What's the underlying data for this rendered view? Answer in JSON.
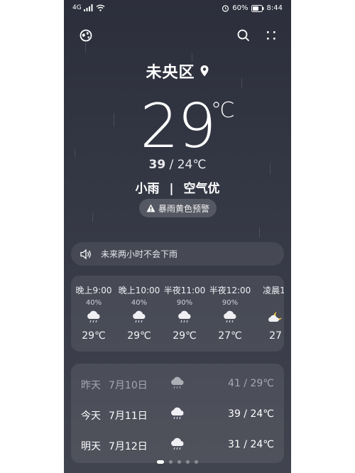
{
  "status_bar": {
    "left_text": "4G",
    "battery": "60%",
    "time": "8:44"
  },
  "location": {
    "city": "未央区"
  },
  "current": {
    "temperature": "29",
    "unit": "℃",
    "high": "39",
    "low_with_unit": "24℃",
    "condition": "小雨",
    "air_quality": "空气优"
  },
  "alert": {
    "text": "暴雨黄色预警"
  },
  "rain_notice": {
    "text": "未来两小时不会下雨"
  },
  "hourly": [
    {
      "time": "晚上9:00",
      "prob": "40%",
      "icon": "rain-cloud-icon",
      "temp": "29℃"
    },
    {
      "time": "晚上10:00",
      "prob": "40%",
      "icon": "rain-cloud-icon",
      "temp": "29℃"
    },
    {
      "time": "半夜11:00",
      "prob": "90%",
      "icon": "rain-cloud-icon",
      "temp": "29℃"
    },
    {
      "time": "半夜12:00",
      "prob": "90%",
      "icon": "rain-cloud-icon",
      "temp": "27℃"
    },
    {
      "time": "凌晨1:",
      "prob": "",
      "icon": "moon-cloud-icon",
      "temp": "27"
    }
  ],
  "daily": [
    {
      "day": "昨天",
      "date": "7月10日",
      "icon": "rain-cloud-icon",
      "range": "41 / 29℃"
    },
    {
      "day": "今天",
      "date": "7月11日",
      "icon": "rain-cloud-icon",
      "range": "39 / 24℃"
    },
    {
      "day": "明天",
      "date": "7月12日",
      "icon": "rain-cloud-icon",
      "range": "31 / 24℃"
    }
  ],
  "page_indicator": {
    "count": 5,
    "active": 0
  },
  "colors": {
    "background_top": "#2c2f3b",
    "background_bottom": "#41444f",
    "text": "#ffffff",
    "moon": "#f3c544"
  }
}
